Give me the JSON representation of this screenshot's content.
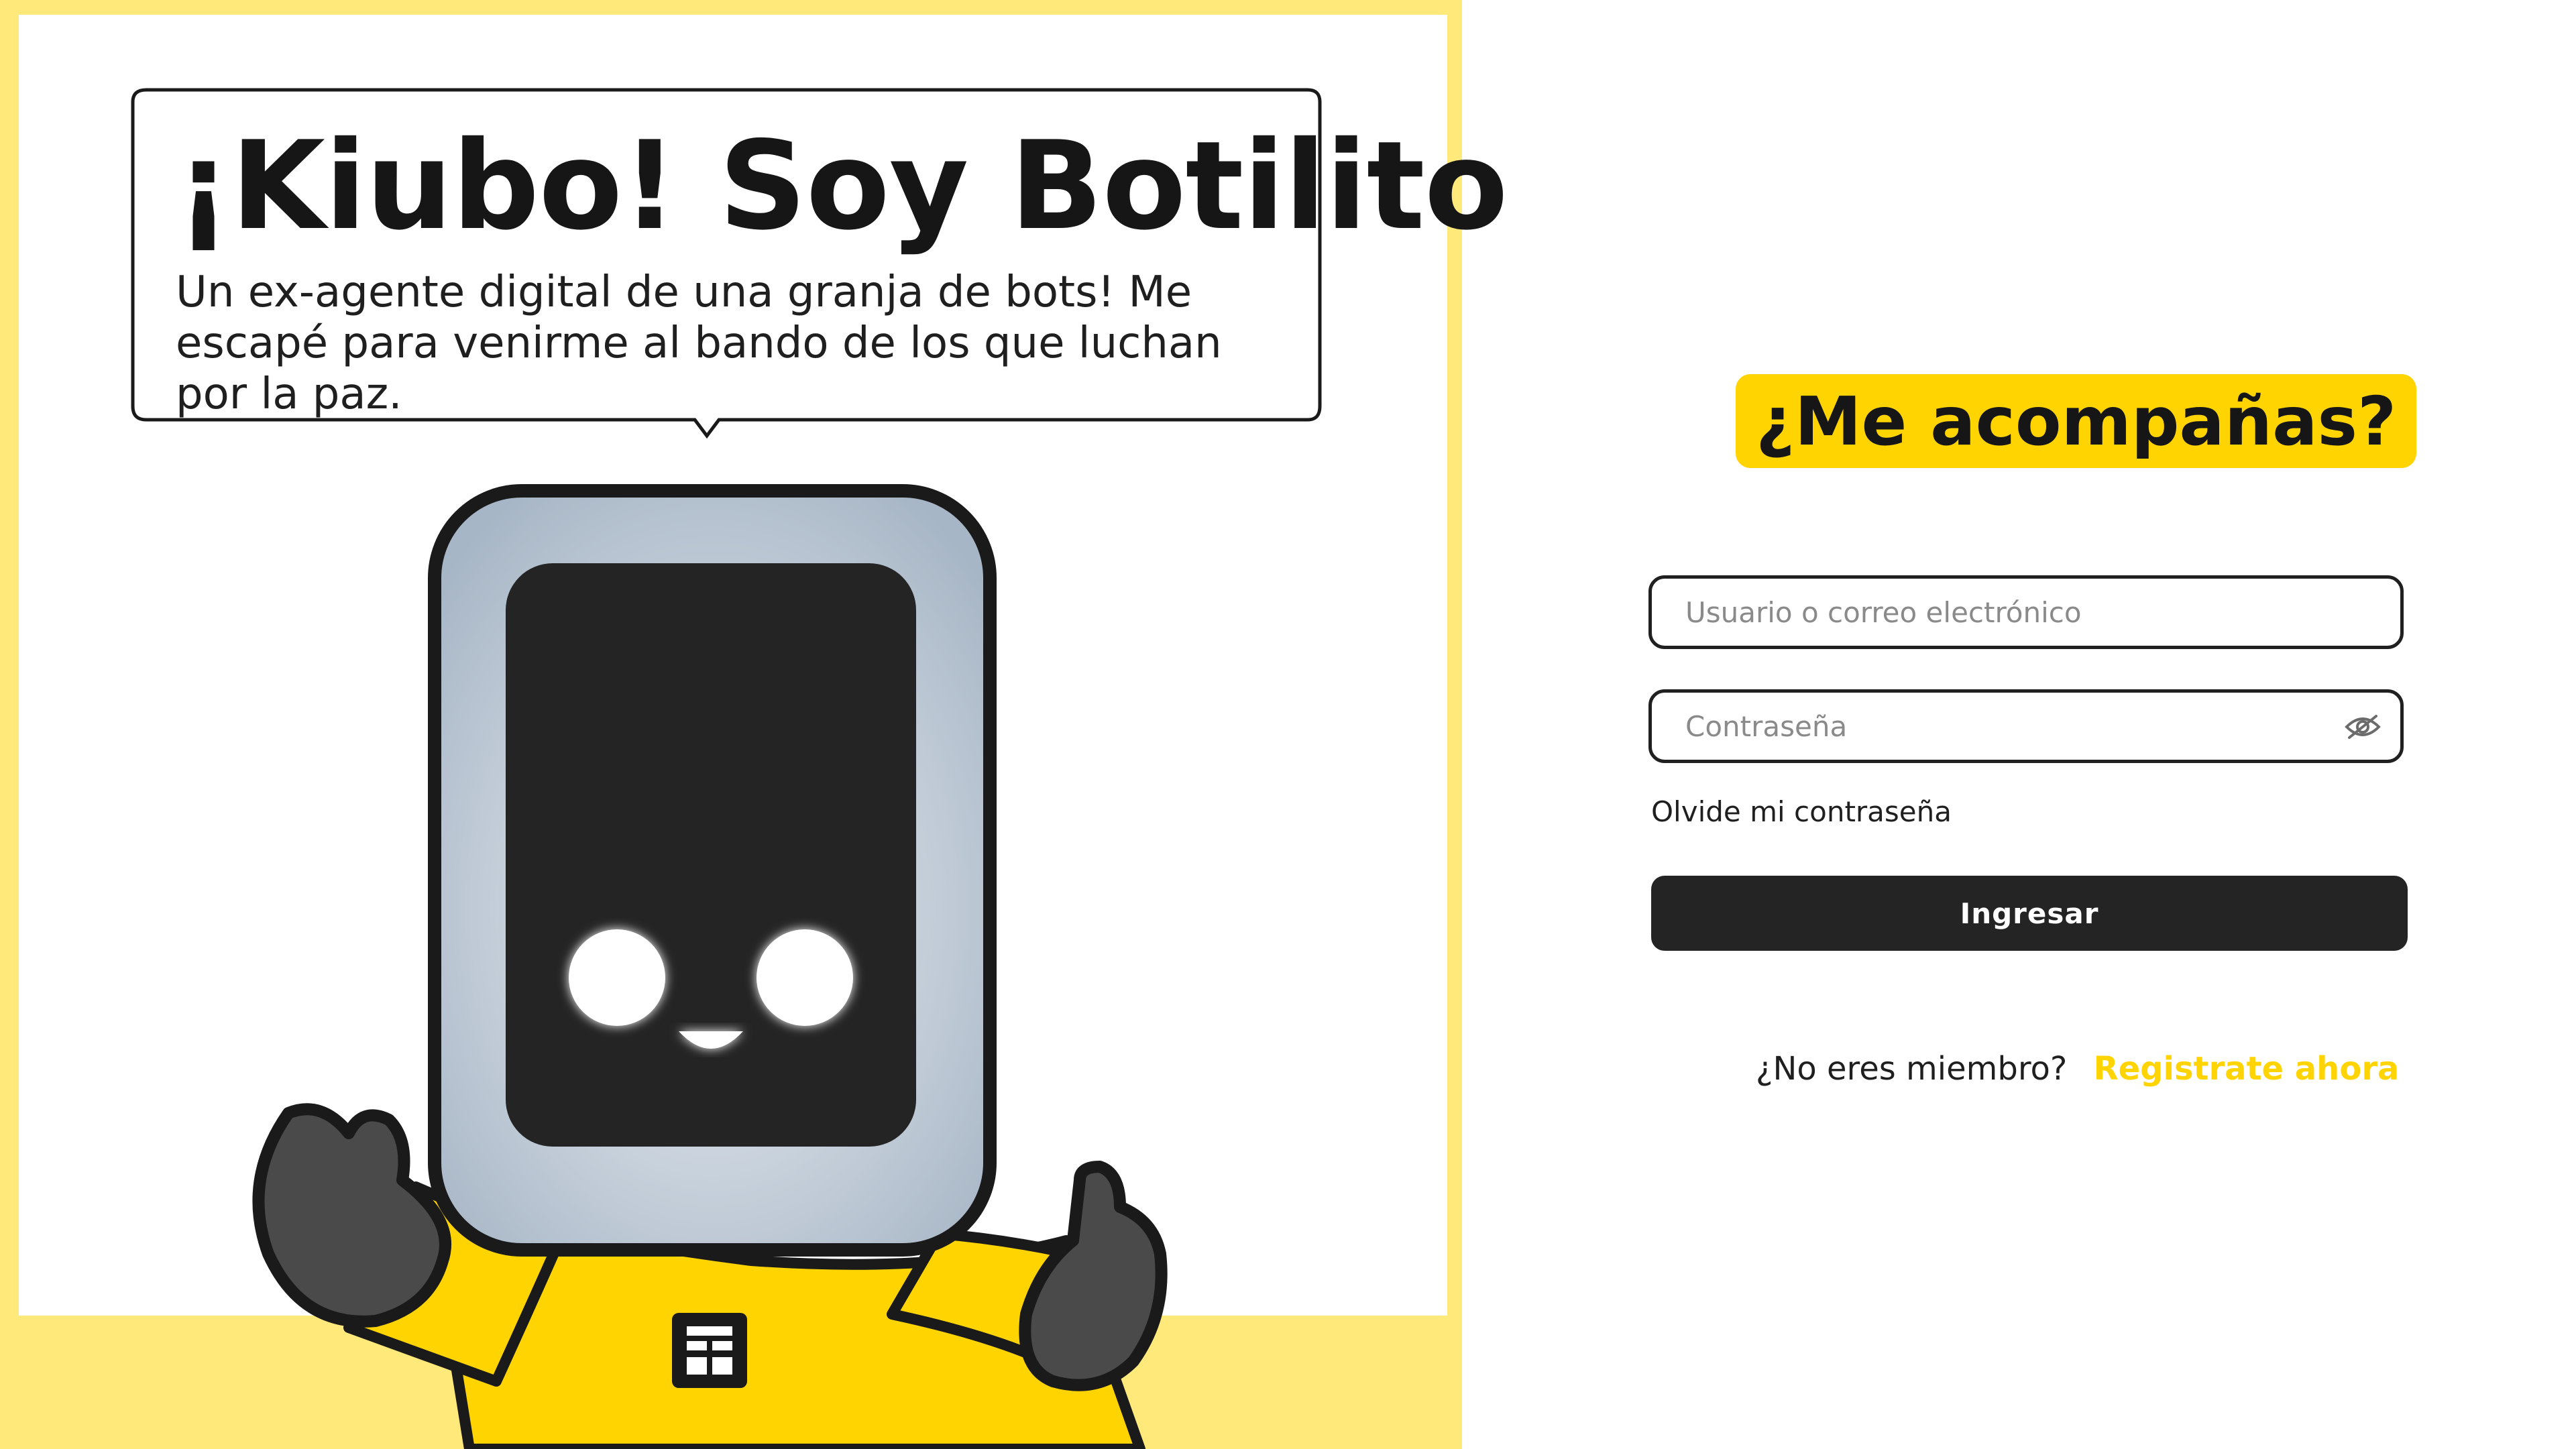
{
  "hero": {
    "title": "¡Kiubo! Soy Botilito",
    "description": "Un ex-agente digital de una granja de bots! Me escapé para venirme al bando de los que luchan por la paz."
  },
  "login": {
    "heading": "¿Me acompañas?",
    "username_placeholder": "Usuario o correo electrónico",
    "password_placeholder": "Contraseña",
    "password_toggle_icon": "eye-off-icon",
    "forgot_password": "Olvide mi contraseña",
    "submit_label": "Ingresar",
    "signup_prompt": "¿No eres miembro?",
    "signup_link": "Registrate ahora"
  },
  "colors": {
    "accent_yellow": "#ffd400",
    "panel_yellow": "#ffe97a",
    "dark": "#242424"
  }
}
